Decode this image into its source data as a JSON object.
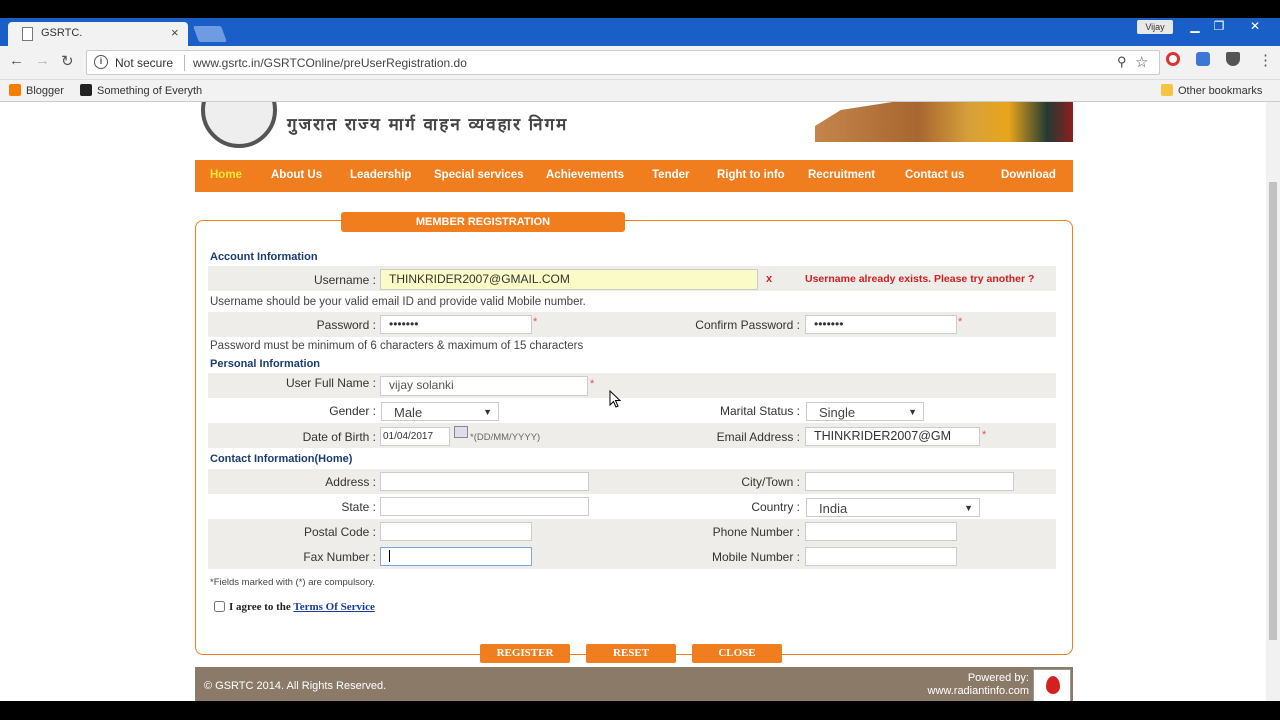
{
  "browser": {
    "tab_title": "GSRTC.",
    "tab_close": "×",
    "user": "Vijay",
    "security": "Not secure",
    "url": "www.gsrtc.in/GSRTCOnline/preUserRegistration.do",
    "bookmarks": [
      "Blogger",
      "Something of Everyth"
    ],
    "other_bookmarks": "Other bookmarks"
  },
  "header": {
    "title_hindi": "गुजरात राज्य मार्ग वाहन व्यवहार निगम"
  },
  "menu": [
    "Home",
    "About Us",
    "Leadership",
    "Special services",
    "Achievements",
    "Tender",
    "Right to info",
    "Recruitment",
    "Contact us",
    "Download"
  ],
  "form": {
    "title": "MEMBER REGISTRATION",
    "account_section": "Account Information",
    "username_label": "Username :",
    "username_value": "THINKRIDER2007@GMAIL.COM",
    "username_error_x": "x",
    "username_error": "Username already exists. Please try another ?",
    "username_hint": "Username should be your valid email ID and provide valid Mobile number.",
    "password_label": "Password :",
    "password_value": "•••••••",
    "confirm_password_label": "Confirm Password :",
    "confirm_password_value": "•••••••",
    "password_hint": "Password must be minimum of 6 characters & maximum of 15 characters",
    "personal_section": "Personal Information",
    "fullname_label": "User Full Name :",
    "fullname_value": "vijay solanki",
    "gender_label": "Gender :",
    "gender_value": "Male",
    "marital_label": "Marital Status :",
    "marital_value": "Single",
    "dob_label": "Date of Birth :",
    "dob_value": "01/04/2017",
    "dob_format": "*(DD/MM/YYYY)",
    "email_label": "Email Address :",
    "email_value": "THINKRIDER2007@GM",
    "contact_section": "Contact Information(Home)",
    "address_label": "Address :",
    "city_label": "City/Town :",
    "state_label": "State :",
    "country_label": "Country :",
    "country_value": "India",
    "postal_label": "Postal Code :",
    "phone_label": "Phone Number :",
    "fax_label": "Fax Number :",
    "mobile_label": "Mobile Number :",
    "required_star": "*",
    "required_note": "*Fields marked with (*) are compulsory.",
    "agree_text": "I agree to the",
    "terms_link": "Terms Of Service",
    "register_button": "REGISTER",
    "reset_button": "RESET",
    "close_button": "CLOSE"
  },
  "footer": {
    "copyright": "© GSRTC 2014. All Rights Reserved.",
    "powered_by": "Powered by:",
    "powered_url": "www.radiantinfo.com"
  }
}
